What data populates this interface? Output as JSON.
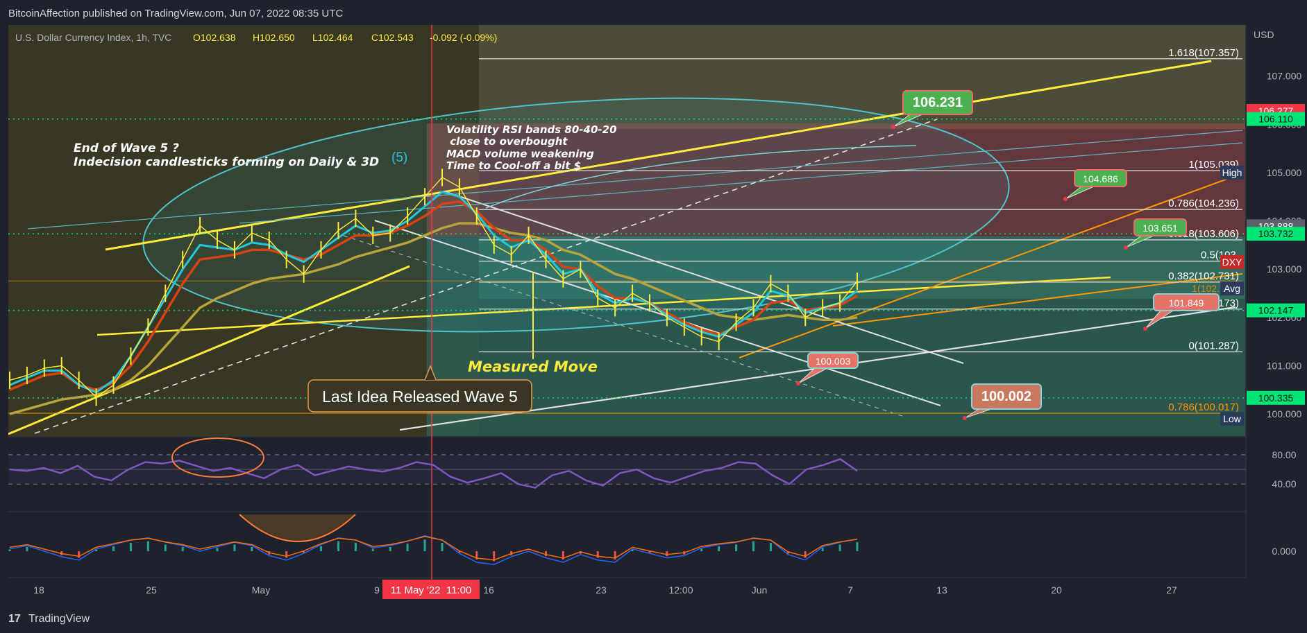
{
  "header": {
    "publish_line": "BitcoinAffection published on TradingView.com, Jun 07, 2022 08:35 UTC",
    "legend": {
      "symbol": "U.S. Dollar Currency Index, 1h, TVC",
      "open": "O102.638",
      "high": "H102.650",
      "low": "L102.464",
      "close": "C102.543",
      "change": "-0.092 (-0.09%)"
    }
  },
  "footer": {
    "brand": "TradingView"
  },
  "colors": {
    "bg": "#1e222d",
    "price": "#ffeb3b",
    "ema_fast": "#26c6da",
    "ema_mid": "#d84315",
    "ema_slow": "#b7a43c",
    "rsi": "#7e57c2",
    "fib_line": "#e0e0e0",
    "fib_orange": "#ff9800",
    "channel": "#ffeb3b",
    "green_label": "#4caf50",
    "red_label": "#f23645"
  },
  "chart_data": {
    "type": "line",
    "currency": "USD",
    "x_ticks": [
      "18",
      "25",
      "May",
      "9",
      "16",
      "23",
      "12:00",
      "Jun",
      "7",
      "13",
      "20",
      "27"
    ],
    "crosshair_time": "11 May '22  11:00",
    "y_ticks": [
      "107.000",
      "106.000",
      "105.000",
      "104.000",
      "103.000",
      "102.000",
      "101.000",
      "100.000"
    ],
    "ylim": [
      99.6,
      108.0
    ],
    "price_series": [
      100.7,
      100.8,
      100.95,
      101.0,
      100.7,
      100.35,
      100.6,
      101.2,
      101.8,
      102.5,
      103.2,
      103.9,
      103.6,
      103.4,
      103.75,
      103.6,
      103.2,
      102.9,
      103.4,
      103.8,
      104.05,
      103.7,
      103.75,
      104.1,
      104.5,
      104.9,
      104.7,
      104.1,
      103.5,
      103.3,
      103.7,
      103.2,
      102.8,
      103.0,
      102.4,
      102.2,
      102.5,
      102.3,
      102.0,
      101.8,
      101.6,
      101.5,
      101.9,
      102.2,
      102.7,
      102.5,
      102.0,
      102.2,
      102.3,
      102.75
    ],
    "ema_fast": [
      100.6,
      100.75,
      100.9,
      100.9,
      100.6,
      100.45,
      100.7,
      101.2,
      101.8,
      102.4,
      103.0,
      103.5,
      103.45,
      103.4,
      103.55,
      103.5,
      103.3,
      103.15,
      103.4,
      103.65,
      103.9,
      103.75,
      103.8,
      104.0,
      104.3,
      104.6,
      104.5,
      104.15,
      103.7,
      103.45,
      103.6,
      103.3,
      102.9,
      103.0,
      102.5,
      102.3,
      102.4,
      102.3,
      102.05,
      101.85,
      101.7,
      101.6,
      101.85,
      102.1,
      102.55,
      102.45,
      102.1,
      102.2,
      102.3,
      102.55
    ],
    "ema_mid": [
      100.5,
      100.65,
      100.8,
      100.85,
      100.6,
      100.5,
      100.65,
      101.0,
      101.5,
      102.1,
      102.7,
      103.2,
      103.25,
      103.3,
      103.4,
      103.4,
      103.3,
      103.2,
      103.3,
      103.5,
      103.7,
      103.7,
      103.75,
      103.9,
      104.1,
      104.35,
      104.4,
      104.2,
      103.85,
      103.6,
      103.6,
      103.4,
      103.05,
      103.0,
      102.65,
      102.4,
      102.4,
      102.3,
      102.1,
      101.9,
      101.75,
      101.65,
      101.8,
      101.95,
      102.3,
      102.35,
      102.15,
      102.2,
      102.25,
      102.45
    ],
    "ema_slow": [
      100.0,
      100.1,
      100.2,
      100.3,
      100.35,
      100.4,
      100.5,
      100.7,
      101.0,
      101.4,
      101.8,
      102.2,
      102.4,
      102.55,
      102.7,
      102.8,
      102.85,
      102.9,
      103.0,
      103.1,
      103.25,
      103.35,
      103.45,
      103.55,
      103.7,
      103.85,
      103.95,
      103.95,
      103.85,
      103.75,
      103.7,
      103.6,
      103.4,
      103.3,
      103.1,
      102.9,
      102.8,
      102.65,
      102.5,
      102.35,
      102.2,
      102.05,
      102.0,
      101.95,
      102.0,
      102.05,
      102.0,
      101.95,
      101.95,
      102.0
    ],
    "fib_levels": [
      {
        "label": "1.618(107.357)",
        "value": 107.357
      },
      {
        "label": "1(105.039)",
        "value": 105.039
      },
      {
        "label": "0.786(104.236)",
        "value": 104.236
      },
      {
        "label": "0.618(103.606)",
        "value": 103.606
      },
      {
        "label": "0.5(103.",
        "value": 103.165
      },
      {
        "label": "0.382(102.731)",
        "value": 102.731
      },
      {
        "label": "0.236(102.173)",
        "value": 102.173
      },
      {
        "label": "0(101.287)",
        "value": 101.287
      }
    ],
    "fib_orange": {
      "label": "0.786(100.017)",
      "value": 100.017,
      "upper_label": "1(102.756)"
    },
    "price_tags": [
      {
        "text": "106.277",
        "value": 106.277,
        "color": "#f23645"
      },
      {
        "text": "106.110",
        "value": 106.11,
        "color": "#00e676"
      },
      {
        "text": "High",
        "value": 105.0,
        "color": "#2a3b5c"
      },
      {
        "text": "103.888",
        "value": 103.888,
        "color": "#5d606b"
      },
      {
        "text": "103.732",
        "value": 103.732,
        "color": "#00e676"
      },
      {
        "text": "DXY",
        "value": 103.15,
        "color": "#c62828"
      },
      {
        "text": "Avg",
        "value": 102.6,
        "color": "#2a3b5c"
      },
      {
        "text": "102.147",
        "value": 102.147,
        "color": "#00e676"
      },
      {
        "text": "100.335",
        "value": 100.335,
        "color": "#00e676"
      },
      {
        "text": "Low",
        "value": 99.9,
        "color": "#2a3b5c"
      }
    ],
    "rsi": {
      "ticks": [
        "80.00",
        "40.00"
      ],
      "bands": [
        80,
        40
      ],
      "values": [
        60,
        58,
        62,
        55,
        65,
        50,
        45,
        60,
        70,
        68,
        72,
        65,
        58,
        62,
        55,
        48,
        60,
        66,
        52,
        58,
        64,
        60,
        57,
        62,
        70,
        66,
        50,
        42,
        48,
        55,
        40,
        35,
        52,
        58,
        45,
        38,
        55,
        60,
        48,
        42,
        50,
        58,
        62,
        70,
        68,
        52,
        40,
        60,
        66,
        74,
        58
      ]
    },
    "macd": {
      "tick": "0.000",
      "values": [
        0.02,
        0.05,
        0.0,
        -0.05,
        -0.08,
        0.02,
        0.06,
        0.1,
        0.12,
        0.08,
        0.05,
        0.0,
        0.04,
        0.08,
        0.05,
        -0.04,
        -0.08,
        -0.02,
        0.06,
        0.12,
        0.1,
        0.03,
        0.05,
        0.09,
        0.14,
        0.1,
        -0.02,
        -0.1,
        -0.12,
        -0.05,
        0.0,
        -0.06,
        -0.1,
        -0.03,
        -0.08,
        -0.1,
        0.02,
        -0.02,
        -0.06,
        -0.04,
        0.03,
        0.06,
        0.08,
        0.12,
        0.1,
        -0.03,
        -0.08,
        0.04,
        0.08,
        0.11
      ]
    },
    "annotations": {
      "wave_end": [
        "End of Wave 5 ?",
        "Indecision candlesticks forming on Daily & 3D"
      ],
      "wave_num": "(5)",
      "volatility": [
        "Volatility RSI bands 80-40-20",
        " close to overbought",
        "MACD volume weakening",
        "Time to Cool-off a bit $"
      ],
      "measured_move": "Measured Move",
      "last_idea": "Last Idea Released Wave 5"
    },
    "callouts": [
      {
        "text": "106.231",
        "color": "#4caf50"
      },
      {
        "text": "104.686",
        "color": "#4caf50"
      },
      {
        "text": "103.651",
        "color": "#4caf50"
      },
      {
        "text": "100.003",
        "color": "#e57368"
      },
      {
        "text": "100.002",
        "color": "#c8785f"
      },
      {
        "text": "101.849",
        "color": "#e57368"
      }
    ]
  }
}
